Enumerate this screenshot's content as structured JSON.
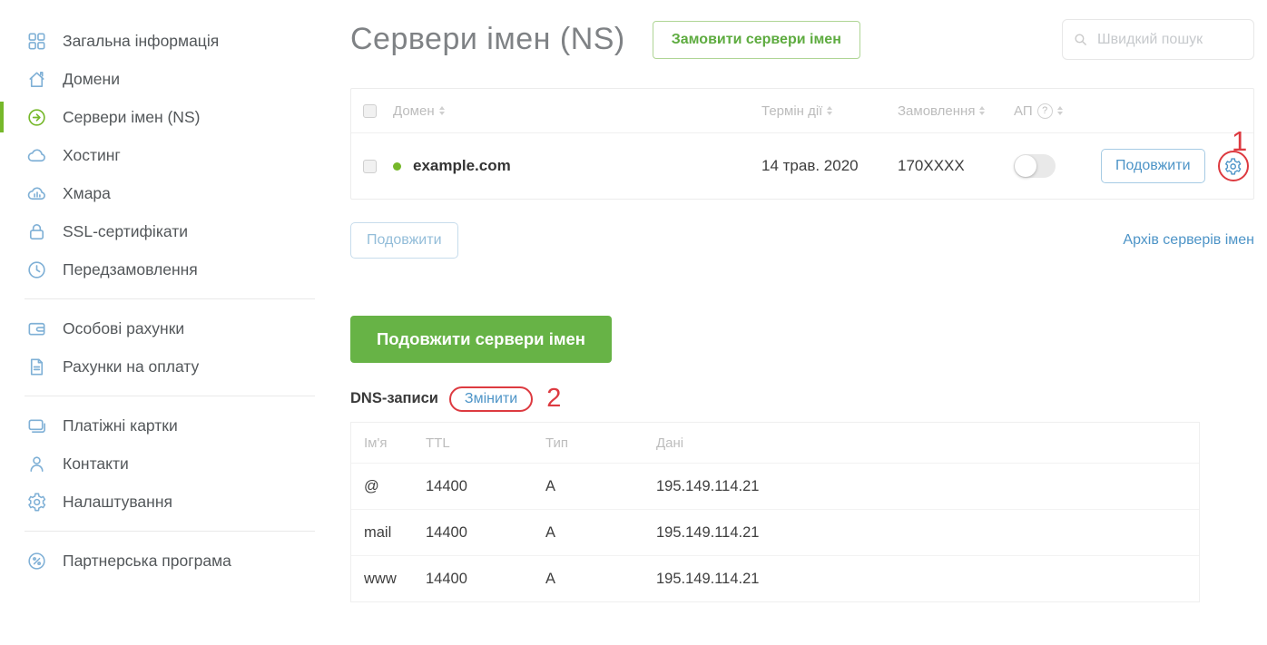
{
  "colors": {
    "accent_green": "#76b82a",
    "button_green": "#67b346",
    "link_blue": "#4d94c7",
    "icon_blue": "#7fb0d6",
    "annotation_red": "#dd3a40"
  },
  "sidebar": {
    "groups": [
      {
        "items": [
          {
            "label": "Загальна інформація",
            "icon": "grid-icon",
            "active": false
          },
          {
            "label": "Домени",
            "icon": "home-icon",
            "active": false
          },
          {
            "label": "Сервери імен (NS)",
            "icon": "arrow-circle-icon",
            "active": true
          },
          {
            "label": "Хостинг",
            "icon": "cloud-icon",
            "active": false
          },
          {
            "label": "Хмара",
            "icon": "cloud-chart-icon",
            "active": false
          },
          {
            "label": "SSL-сертифікати",
            "icon": "lock-icon",
            "active": false
          },
          {
            "label": "Передзамовлення",
            "icon": "clock-icon",
            "active": false
          }
        ]
      },
      {
        "items": [
          {
            "label": "Особові рахунки",
            "icon": "wallet-icon",
            "active": false
          },
          {
            "label": "Рахунки на оплату",
            "icon": "invoice-icon",
            "active": false
          }
        ]
      },
      {
        "items": [
          {
            "label": "Платіжні картки",
            "icon": "cards-icon",
            "active": false
          },
          {
            "label": "Контакти",
            "icon": "person-icon",
            "active": false
          },
          {
            "label": "Налаштування",
            "icon": "gear-icon",
            "active": false
          }
        ]
      },
      {
        "items": [
          {
            "label": "Партнерська програма",
            "icon": "percent-icon",
            "active": false
          }
        ]
      }
    ]
  },
  "header": {
    "title": "Сервери імен (NS)",
    "order_button": "Замовити сервери імен",
    "search_placeholder": "Швидкий пошук"
  },
  "ns_table": {
    "columns": [
      "Домен",
      "Термін дії",
      "Замовлення",
      "АП"
    ],
    "rows": [
      {
        "domain": "example.com",
        "status_dot": "active",
        "expires": "14 трав. 2020",
        "order": "170XXXX",
        "autoprolong": false,
        "action_label": "Подовжити"
      }
    ]
  },
  "below_table": {
    "prolong_button": "Подовжити",
    "archive_link": "Архів серверів імен"
  },
  "prolong_section": {
    "button": "Подовжити сервери імен"
  },
  "dns": {
    "title": "DNS-записи",
    "edit_link": "Змінити",
    "columns": [
      "Ім'я",
      "TTL",
      "Тип",
      "Дані"
    ],
    "rows": [
      {
        "name": "@",
        "ttl": "14400",
        "type": "A",
        "data": "195.149.114.21"
      },
      {
        "name": "mail",
        "ttl": "14400",
        "type": "A",
        "data": "195.149.114.21"
      },
      {
        "name": "www",
        "ttl": "14400",
        "type": "A",
        "data": "195.149.114.21"
      }
    ]
  },
  "annotations": {
    "marker1": "1",
    "marker2": "2"
  }
}
